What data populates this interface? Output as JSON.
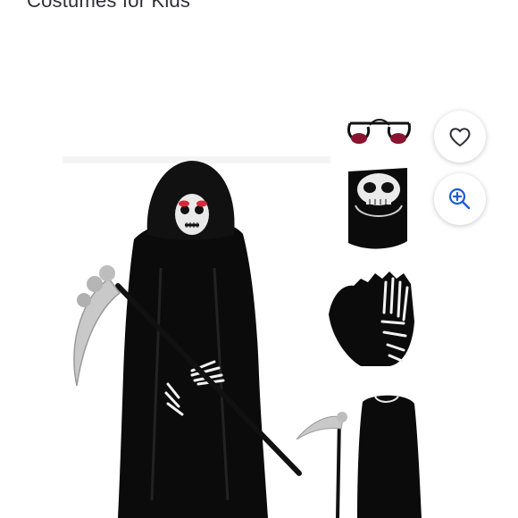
{
  "product": {
    "title": "Costumes for Kids"
  },
  "actions": {
    "favorite_icon": "heart-icon",
    "zoom_icon": "zoom-in-icon"
  },
  "colors": {
    "accent": "#1a5bd8",
    "text": "#2e2e38",
    "costume": "#0b0b0b",
    "eyes": "#d8283a"
  }
}
